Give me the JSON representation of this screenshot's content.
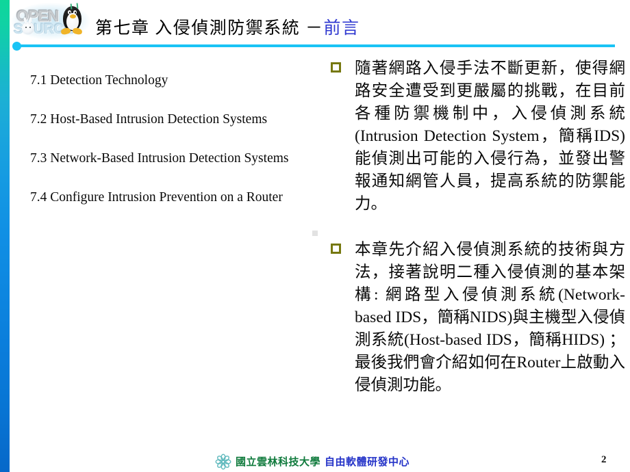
{
  "slide": {
    "header": {
      "title_main": "第七章 入侵偵測防禦系統 －",
      "title_accent": "前言",
      "logo_word_top": "OPEN",
      "logo_word_bottom": "SOURCE",
      "accent_color": "#19c3f5",
      "title_accent_color": "#2f38d0"
    },
    "agenda": {
      "items": [
        "7.1 Detection Technology",
        "7.2 Host-Based Intrusion Detection Systems",
        "7.3 Network-Based Intrusion Detection Systems",
        "7.4 Configure Intrusion Prevention on a Router"
      ]
    },
    "bullets": {
      "marker_color": "#76780f",
      "items": [
        "隨著網路入侵手法不斷更新，使得網路安全遭受到更嚴屬的挑戰，在目前各種防禦機制中，入侵偵測系統(Intrusion Detection System，簡稱IDS)能偵測出可能的入侵行為，並發出警報通知網管人員，提高系統的防禦能力。",
        "本章先介紹入侵偵測系統的技術與方法，接著說明二種入侵偵測的基本架構: 網路型入侵偵測系統(Network-based IDS，簡稱NIDS)與主機型入侵偵測系統(Host-based IDS，簡稱HIDS) ；最後我們會介紹如何在Router上啟動入侵偵測功能。"
      ]
    },
    "footer": {
      "university": "國立雲林科技大學",
      "center": "自由軟體研發中心",
      "page_number": "2",
      "university_color": "#0f7a3c",
      "center_color": "#2433c8",
      "flower_color": "#5fb9bd"
    }
  }
}
